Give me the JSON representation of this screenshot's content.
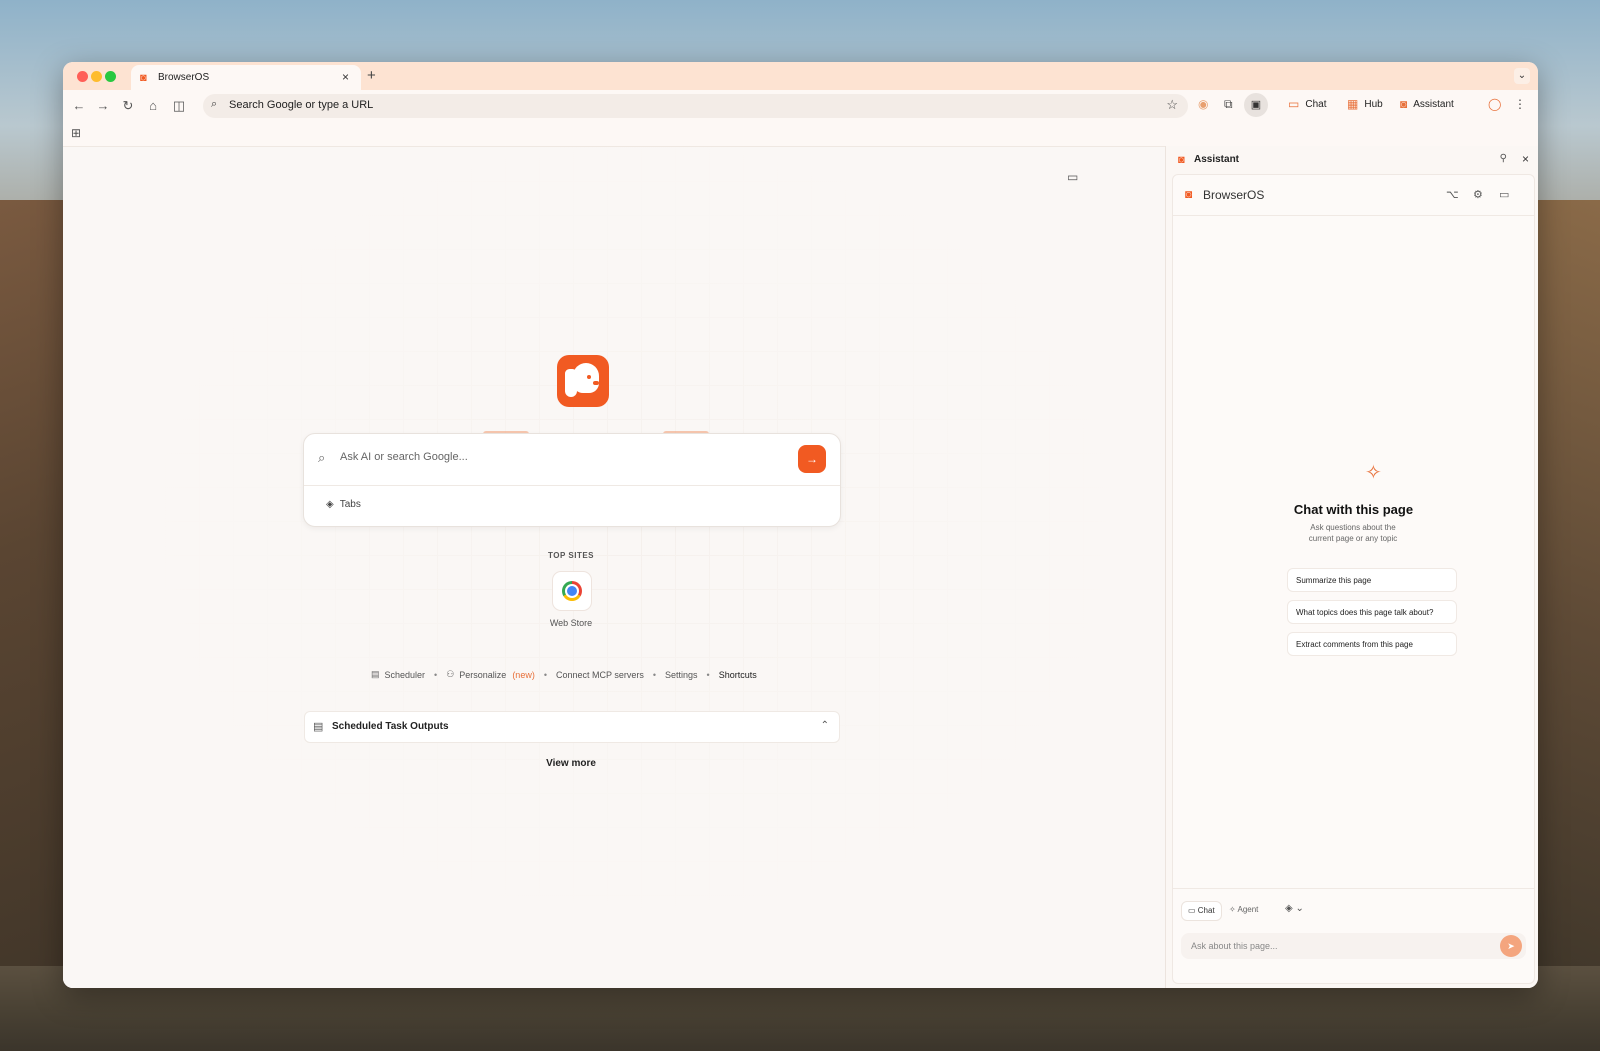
{
  "tab": {
    "title": "BrowserOS",
    "close": "×",
    "new_tab": "+",
    "menu": "⌄"
  },
  "toolbar": {
    "back": "←",
    "forward": "→",
    "reload": "↻",
    "home": "⌂",
    "split": "◫",
    "omnibox_text": "Search Google or type a URL",
    "star": "☆",
    "chat_label": "Chat",
    "hub_label": "Hub",
    "assistant_label": "Assistant",
    "profile": "◯",
    "more": "⋮"
  },
  "content": {
    "search_placeholder": "Ask AI or search Google...",
    "go_glyph": "→",
    "tabs_chip": "Tabs",
    "top_sites_label": "TOP SITES",
    "top_sites": [
      {
        "label": "Web Store"
      }
    ],
    "links": {
      "scheduler": "Scheduler",
      "personalize": "Personalize",
      "personalize_badge": "(new)",
      "connect_mcp": "Connect MCP servers",
      "settings": "Settings",
      "shortcuts": "Shortcuts",
      "sep": "•"
    },
    "scheduled_title": "Scheduled Task Outputs",
    "view_more": "View more"
  },
  "assistant": {
    "panel_title": "Assistant",
    "app_name": "BrowserOS",
    "chat_title": "Chat with this page",
    "chat_subtitle": "Ask questions about the current page or any topic",
    "suggestions": [
      "Summarize this page",
      "What topics does this page talk about?",
      "Extract comments from this page"
    ],
    "mode_chat": "Chat",
    "mode_agent": "Agent",
    "input_placeholder": "Ask about this page..."
  },
  "colors": {
    "accent": "#f15a22",
    "tabbar": "#fde3d2"
  }
}
